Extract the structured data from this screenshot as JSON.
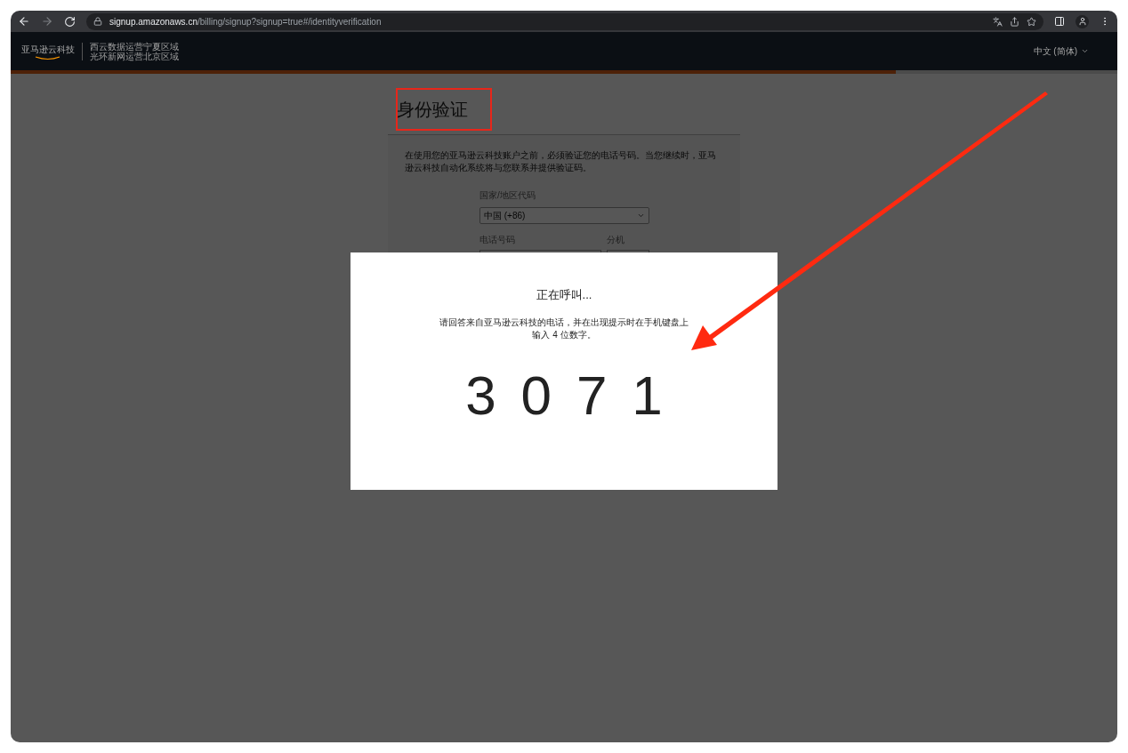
{
  "browser": {
    "url_host": "signup.amazonaws.cn",
    "url_path": "/billing/signup?signup=true#/identityverification"
  },
  "header": {
    "logo": "亚马逊云科技",
    "regions": [
      "西云数据运营宁夏区域",
      "光环新网运营北京区域"
    ],
    "language": "中文 (简体)"
  },
  "progress": {
    "level": 0.8
  },
  "page": {
    "title": "身份验证",
    "intro": "在使用您的亚马逊云科技账户之前，必须验证您的电话号码。当您继续时，亚马逊云科技自动化系统将与您联系并提供验证码。",
    "country_label": "国家/地区代码",
    "country_value": "中国 (+86)",
    "phone_label": "电话号码",
    "extension_label": "分机"
  },
  "modal": {
    "title": "正在呼叫...",
    "message": "请回答来自亚马逊云科技的电话，并在出现提示时在手机键盘上输入 4 位数字。",
    "code": "3071"
  }
}
